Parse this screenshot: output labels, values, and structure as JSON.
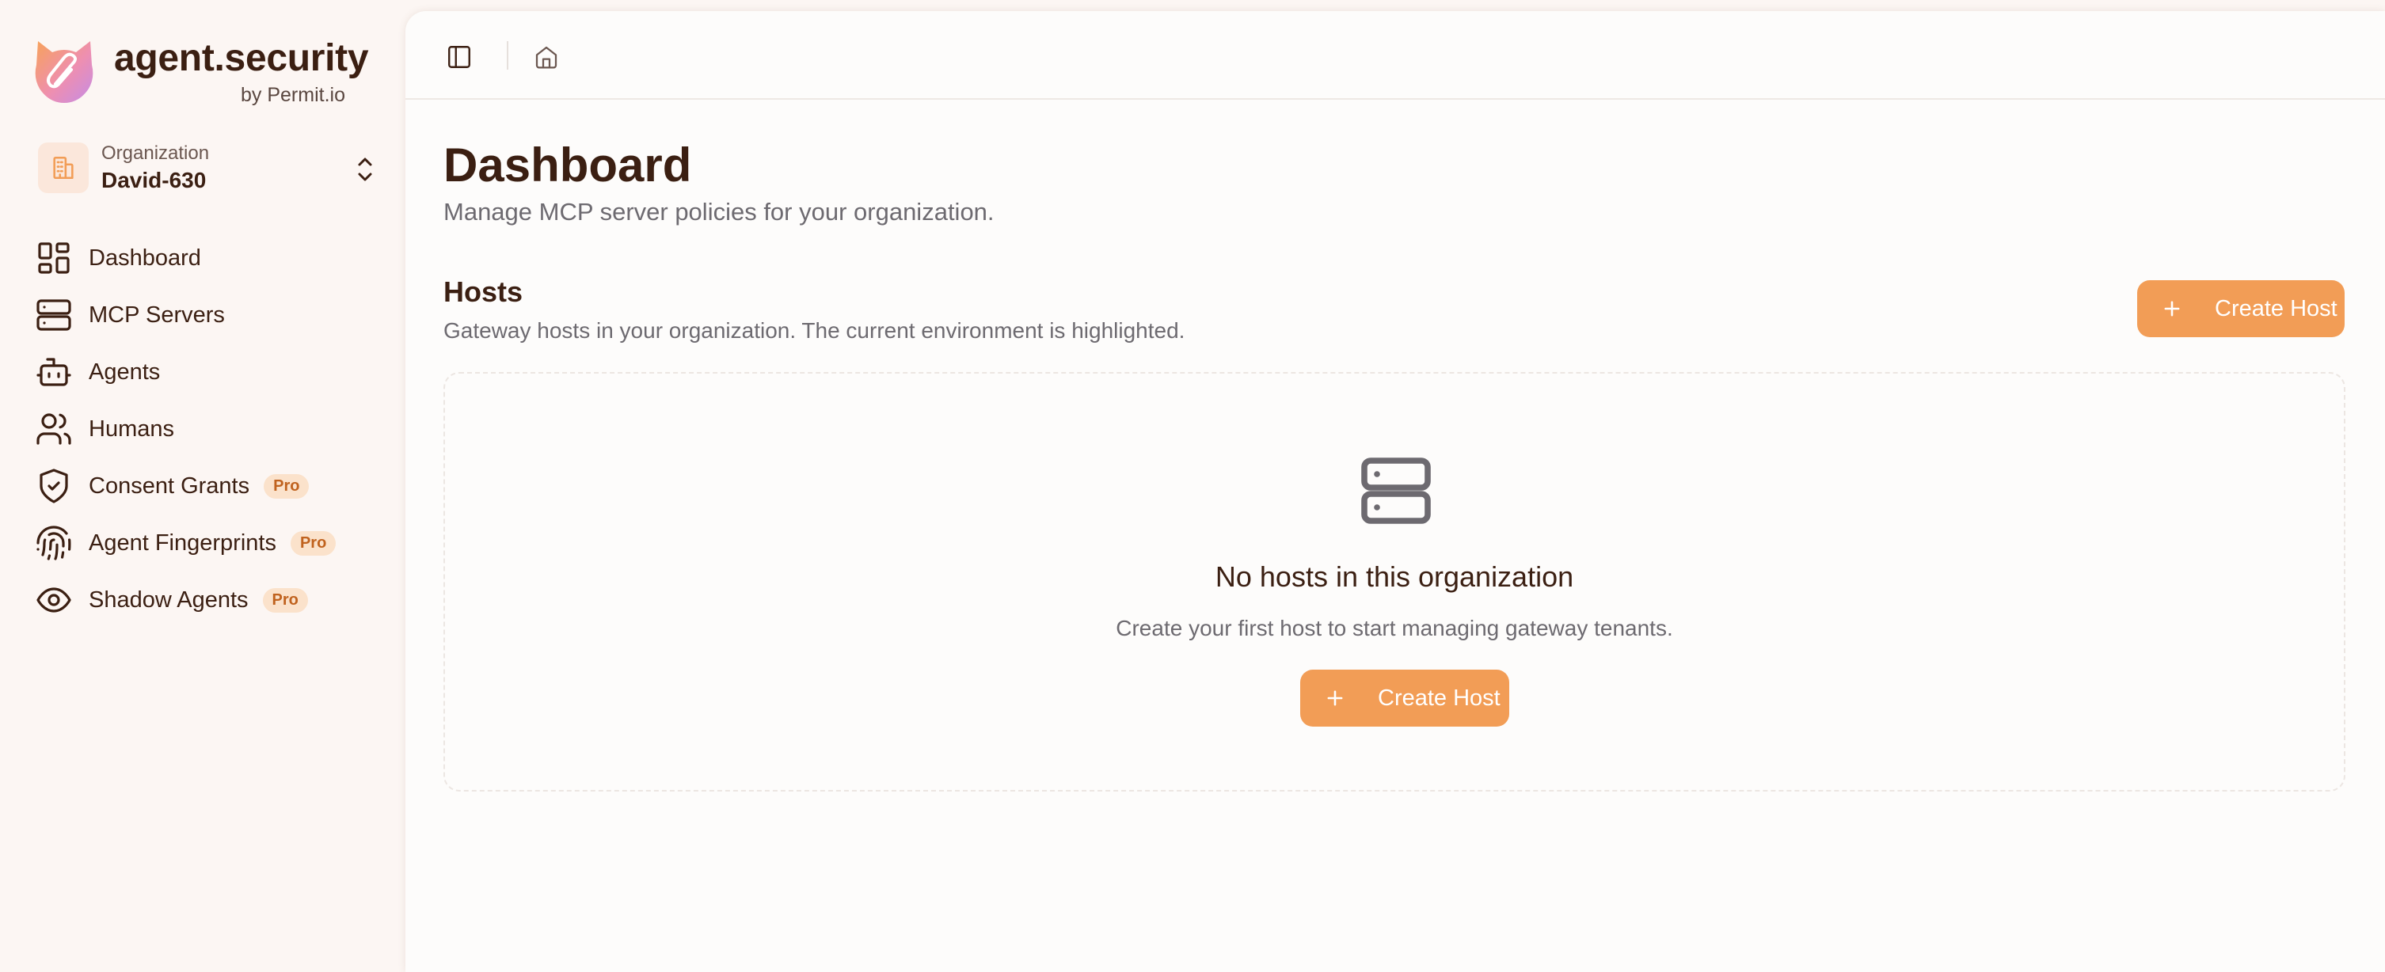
{
  "brand": {
    "name": "agent.security",
    "byline": "by Permit.io"
  },
  "organization": {
    "label": "Organization",
    "name": "David-630"
  },
  "sidebar": {
    "items": [
      {
        "label": "Dashboard",
        "icon": "dashboard-icon"
      },
      {
        "label": "MCP Servers",
        "icon": "server-icon"
      },
      {
        "label": "Agents",
        "icon": "bot-icon"
      },
      {
        "label": "Humans",
        "icon": "users-icon"
      },
      {
        "label": "Consent Grants",
        "icon": "shield-check-icon",
        "badge": "Pro"
      },
      {
        "label": "Agent Fingerprints",
        "icon": "fingerprint-icon",
        "badge": "Pro"
      },
      {
        "label": "Shadow Agents",
        "icon": "eye-icon",
        "badge": "Pro"
      }
    ]
  },
  "topbar": {
    "toggle_icon": "sidebar-toggle-icon",
    "home_icon": "home-icon"
  },
  "page": {
    "title": "Dashboard",
    "subtitle": "Manage MCP server policies for your organization."
  },
  "hosts": {
    "title": "Hosts",
    "subtitle": "Gateway hosts in your organization. The current environment is highlighted.",
    "create_label": "Create Host",
    "empty": {
      "icon": "server-icon",
      "title": "No hosts in this organization",
      "subtitle": "Create your first host to start managing gateway tenants.",
      "create_label": "Create Host"
    }
  },
  "colors": {
    "accent": "#f29d56",
    "badge_bg": "#fbe2cb",
    "badge_text": "#c0621e",
    "sidebar_bg": "#fcf6f3",
    "text_primary": "#3b1f12",
    "text_muted": "#6d6a70"
  }
}
